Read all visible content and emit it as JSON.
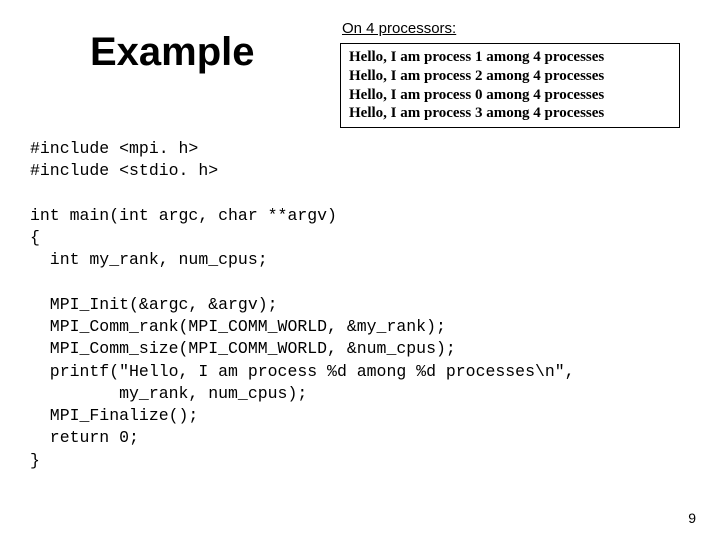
{
  "title": "Example",
  "output": {
    "heading": "On 4 processors:",
    "lines": [
      "Hello, I am process 1 among 4 processes",
      "Hello, I am process 2 among 4 processes",
      "Hello, I am process 0 among 4 processes",
      "Hello, I am process 3 among 4 processes"
    ]
  },
  "code": "#include <mpi. h>\n#include <stdio. h>\n\nint main(int argc, char **argv)\n{\n  int my_rank, num_cpus;\n\n  MPI_Init(&argc, &argv);\n  MPI_Comm_rank(MPI_COMM_WORLD, &my_rank);\n  MPI_Comm_size(MPI_COMM_WORLD, &num_cpus);\n  printf(\"Hello, I am process %d among %d processes\\n\",\n         my_rank, num_cpus);\n  MPI_Finalize();\n  return 0;\n}",
  "page_number": "9"
}
